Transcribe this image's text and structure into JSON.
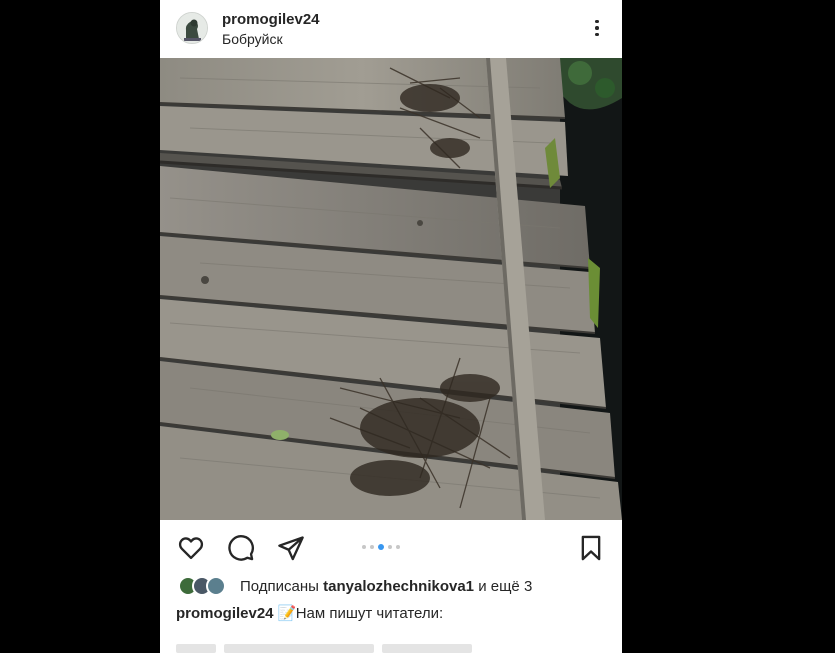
{
  "post": {
    "username": "promogilev24",
    "location": "Бобруйск",
    "avatar_icon": "lion-statue-avatar",
    "more_icon": "more-vertical-icon",
    "photo_alt": "",
    "actions": {
      "like_icon": "heart-icon",
      "comment_icon": "comment-icon",
      "share_icon": "send-icon",
      "save_icon": "bookmark-icon"
    },
    "carousel": {
      "count": 5,
      "active_index": 2,
      "active_color": "#3897f0",
      "inactive_color": "#c7c7c7"
    },
    "likes": {
      "prefix": "Подписаны",
      "user": "tanyalozhechnikova1",
      "suffix": "и ещё 3"
    },
    "caption": {
      "username": "promogilev24",
      "emoji": "📝",
      "text": "Нам пишут читатели:"
    }
  },
  "colors": {
    "page_bg": "#000000",
    "card_bg": "#ffffff",
    "text": "#262626"
  }
}
